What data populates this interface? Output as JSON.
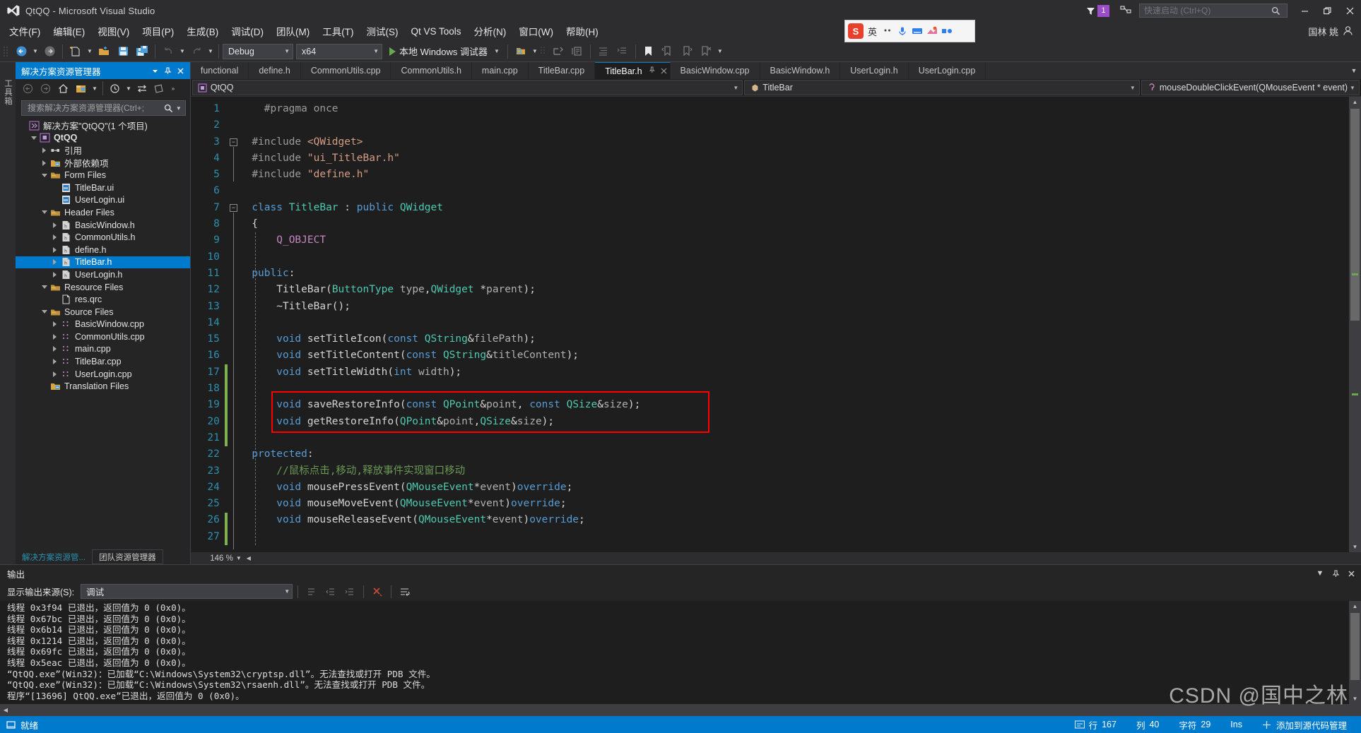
{
  "window": {
    "title": "QtQQ - Microsoft Visual Studio",
    "minimize_label": "–",
    "restore_label": "❐",
    "close_label": "✕",
    "notification_count": "1"
  },
  "quick_launch": {
    "placeholder": "快速启动 (Ctrl+Q)",
    "value": ""
  },
  "menu": {
    "items": [
      "文件(F)",
      "编辑(E)",
      "视图(V)",
      "项目(P)",
      "生成(B)",
      "调试(D)",
      "团队(M)",
      "工具(T)",
      "测试(S)",
      "Qt VS Tools",
      "分析(N)",
      "窗口(W)",
      "帮助(H)"
    ],
    "user": "国林 姚"
  },
  "ime_toolbar": {
    "s_logo": "S",
    "mode": "英"
  },
  "toolbar": {
    "config": "Debug",
    "platform": "x64",
    "run_label": "本地 Windows 调试器"
  },
  "solution_explorer": {
    "title": "解决方案资源管理器",
    "search_placeholder": "搜索解决方案资源管理器(Ctrl+;",
    "tree": [
      {
        "depth": 0,
        "arrow": "none",
        "icon": "solution-icon",
        "label": "解决方案\"QtQQ\"(1 个项目)",
        "bold": false,
        "selected": false
      },
      {
        "depth": 1,
        "arrow": "down",
        "icon": "project-icon",
        "label": "QtQQ",
        "bold": true,
        "selected": false
      },
      {
        "depth": 2,
        "arrow": "right",
        "icon": "references-icon",
        "label": "引用",
        "bold": false,
        "selected": false
      },
      {
        "depth": 2,
        "arrow": "right",
        "icon": "folder-ext-icon",
        "label": "外部依赖项",
        "bold": false,
        "selected": false
      },
      {
        "depth": 2,
        "arrow": "down",
        "icon": "filter-icon",
        "label": "Form Files",
        "bold": false,
        "selected": false
      },
      {
        "depth": 3,
        "arrow": "none",
        "icon": "ui-file-icon",
        "label": "TitleBar.ui",
        "bold": false,
        "selected": false
      },
      {
        "depth": 3,
        "arrow": "none",
        "icon": "ui-file-icon",
        "label": "UserLogin.ui",
        "bold": false,
        "selected": false
      },
      {
        "depth": 2,
        "arrow": "down",
        "icon": "filter-icon",
        "label": "Header Files",
        "bold": false,
        "selected": false
      },
      {
        "depth": 3,
        "arrow": "right",
        "icon": "h-file-icon",
        "label": "BasicWindow.h",
        "bold": false,
        "selected": false
      },
      {
        "depth": 3,
        "arrow": "right",
        "icon": "h-file-icon",
        "label": "CommonUtils.h",
        "bold": false,
        "selected": false
      },
      {
        "depth": 3,
        "arrow": "right",
        "icon": "h-file-icon",
        "label": "define.h",
        "bold": false,
        "selected": false
      },
      {
        "depth": 3,
        "arrow": "right",
        "icon": "h-file-icon",
        "label": "TitleBar.h",
        "bold": false,
        "selected": true
      },
      {
        "depth": 3,
        "arrow": "right",
        "icon": "h-file-icon",
        "label": "UserLogin.h",
        "bold": false,
        "selected": false
      },
      {
        "depth": 2,
        "arrow": "down",
        "icon": "filter-icon",
        "label": "Resource Files",
        "bold": false,
        "selected": false
      },
      {
        "depth": 3,
        "arrow": "none",
        "icon": "file-icon",
        "label": "res.qrc",
        "bold": false,
        "selected": false
      },
      {
        "depth": 2,
        "arrow": "down",
        "icon": "filter-icon",
        "label": "Source Files",
        "bold": false,
        "selected": false
      },
      {
        "depth": 3,
        "arrow": "right",
        "icon": "cpp-file-icon",
        "label": "BasicWindow.cpp",
        "bold": false,
        "selected": false
      },
      {
        "depth": 3,
        "arrow": "right",
        "icon": "cpp-file-icon",
        "label": "CommonUtils.cpp",
        "bold": false,
        "selected": false
      },
      {
        "depth": 3,
        "arrow": "right",
        "icon": "cpp-file-icon",
        "label": "main.cpp",
        "bold": false,
        "selected": false
      },
      {
        "depth": 3,
        "arrow": "right",
        "icon": "cpp-file-icon",
        "label": "TitleBar.cpp",
        "bold": false,
        "selected": false
      },
      {
        "depth": 3,
        "arrow": "right",
        "icon": "cpp-file-icon",
        "label": "UserLogin.cpp",
        "bold": false,
        "selected": false
      },
      {
        "depth": 2,
        "arrow": "none",
        "icon": "folder-ext-icon",
        "label": "Translation Files",
        "bold": false,
        "selected": false
      }
    ],
    "bottom_tabs": [
      {
        "label": "解决方案资源管...",
        "active": true
      },
      {
        "label": "团队资源管理器",
        "active": false
      }
    ]
  },
  "vertical_tabs": [
    "工具箱"
  ],
  "editor": {
    "tabs": [
      {
        "label": "functional",
        "active": false
      },
      {
        "label": "define.h",
        "active": false
      },
      {
        "label": "CommonUtils.cpp",
        "active": false
      },
      {
        "label": "CommonUtils.h",
        "active": false
      },
      {
        "label": "main.cpp",
        "active": false
      },
      {
        "label": "TitleBar.cpp",
        "active": false
      },
      {
        "label": "TitleBar.h",
        "active": true
      },
      {
        "label": "BasicWindow.cpp",
        "active": false
      },
      {
        "label": "BasicWindow.h",
        "active": false
      },
      {
        "label": "UserLogin.h",
        "active": false
      },
      {
        "label": "UserLogin.cpp",
        "active": false
      }
    ],
    "nav_project": "QtQQ",
    "nav_class": "TitleBar",
    "nav_member": "mouseDoubleClickEvent(QMouseEvent * event)",
    "zoom": "146 %",
    "highlight_color": "#ff0000",
    "lines": [
      {
        "n": 1,
        "tokens": [
          {
            "t": "    ",
            "c": "pl"
          },
          {
            "t": "#pragma once",
            "c": "pp"
          }
        ]
      },
      {
        "n": 2,
        "tokens": []
      },
      {
        "n": 3,
        "tokens": [
          {
            "t": "  ",
            "c": "pl"
          },
          {
            "t": "#include ",
            "c": "pp"
          },
          {
            "t": "<QWidget>",
            "c": "str"
          }
        ]
      },
      {
        "n": 4,
        "tokens": [
          {
            "t": "  ",
            "c": "pl"
          },
          {
            "t": "#include ",
            "c": "pp"
          },
          {
            "t": "\"ui_TitleBar.h\"",
            "c": "str"
          }
        ]
      },
      {
        "n": 5,
        "tokens": [
          {
            "t": "  ",
            "c": "pl"
          },
          {
            "t": "#include ",
            "c": "pp"
          },
          {
            "t": "\"define.h\"",
            "c": "str"
          }
        ]
      },
      {
        "n": 6,
        "tokens": []
      },
      {
        "n": 7,
        "tokens": [
          {
            "t": "  ",
            "c": "pl"
          },
          {
            "t": "class",
            "c": "k"
          },
          {
            "t": " ",
            "c": "pl"
          },
          {
            "t": "TitleBar",
            "c": "kv"
          },
          {
            "t": " : ",
            "c": "pl"
          },
          {
            "t": "public",
            "c": "k"
          },
          {
            "t": " ",
            "c": "pl"
          },
          {
            "t": "QWidget",
            "c": "kv"
          }
        ]
      },
      {
        "n": 8,
        "tokens": [
          {
            "t": "  {",
            "c": "pl"
          }
        ]
      },
      {
        "n": 9,
        "tokens": [
          {
            "t": "      ",
            "c": "pl"
          },
          {
            "t": "Q_OBJECT",
            "c": "mac"
          }
        ]
      },
      {
        "n": 10,
        "tokens": []
      },
      {
        "n": 11,
        "tokens": [
          {
            "t": "  ",
            "c": "pl"
          },
          {
            "t": "public",
            "c": "k"
          },
          {
            "t": ":",
            "c": "pl"
          }
        ]
      },
      {
        "n": 12,
        "tokens": [
          {
            "t": "      ",
            "c": "pl"
          },
          {
            "t": "TitleBar",
            "c": "pl"
          },
          {
            "t": "(",
            "c": "pl"
          },
          {
            "t": "ButtonType",
            "c": "kv"
          },
          {
            "t": " ",
            "c": "pl"
          },
          {
            "t": "type",
            "c": "pg"
          },
          {
            "t": ",",
            "c": "pl"
          },
          {
            "t": "QWidget",
            "c": "kv"
          },
          {
            "t": " *",
            "c": "pl"
          },
          {
            "t": "parent",
            "c": "pg"
          },
          {
            "t": ");",
            "c": "pl"
          }
        ]
      },
      {
        "n": 13,
        "tokens": [
          {
            "t": "      ~TitleBar();",
            "c": "pl"
          }
        ]
      },
      {
        "n": 14,
        "tokens": []
      },
      {
        "n": 15,
        "tokens": [
          {
            "t": "      ",
            "c": "pl"
          },
          {
            "t": "void",
            "c": "k"
          },
          {
            "t": " setTitleIcon(",
            "c": "pl"
          },
          {
            "t": "const",
            "c": "k"
          },
          {
            "t": " ",
            "c": "pl"
          },
          {
            "t": "QString",
            "c": "kv"
          },
          {
            "t": "&",
            "c": "pl"
          },
          {
            "t": "filePath",
            "c": "pg"
          },
          {
            "t": ");",
            "c": "pl"
          }
        ]
      },
      {
        "n": 16,
        "tokens": [
          {
            "t": "      ",
            "c": "pl"
          },
          {
            "t": "void",
            "c": "k"
          },
          {
            "t": " setTitleContent(",
            "c": "pl"
          },
          {
            "t": "const",
            "c": "k"
          },
          {
            "t": " ",
            "c": "pl"
          },
          {
            "t": "QString",
            "c": "kv"
          },
          {
            "t": "&",
            "c": "pl"
          },
          {
            "t": "titleContent",
            "c": "pg"
          },
          {
            "t": ");",
            "c": "pl"
          }
        ]
      },
      {
        "n": 17,
        "tokens": [
          {
            "t": "      ",
            "c": "pl"
          },
          {
            "t": "void",
            "c": "k"
          },
          {
            "t": " setTitleWidth(",
            "c": "pl"
          },
          {
            "t": "int",
            "c": "k"
          },
          {
            "t": " ",
            "c": "pl"
          },
          {
            "t": "width",
            "c": "pg"
          },
          {
            "t": ");",
            "c": "pl"
          }
        ]
      },
      {
        "n": 18,
        "tokens": []
      },
      {
        "n": 19,
        "tokens": [
          {
            "t": "      ",
            "c": "pl"
          },
          {
            "t": "void",
            "c": "k"
          },
          {
            "t": " saveRestoreInfo(",
            "c": "pl"
          },
          {
            "t": "const",
            "c": "k"
          },
          {
            "t": " ",
            "c": "pl"
          },
          {
            "t": "QPoint",
            "c": "kv"
          },
          {
            "t": "&",
            "c": "pl"
          },
          {
            "t": "point",
            "c": "pg"
          },
          {
            "t": ", ",
            "c": "pl"
          },
          {
            "t": "const",
            "c": "k"
          },
          {
            "t": " ",
            "c": "pl"
          },
          {
            "t": "QSize",
            "c": "kv"
          },
          {
            "t": "&",
            "c": "pl"
          },
          {
            "t": "size",
            "c": "pg"
          },
          {
            "t": ");",
            "c": "pl"
          }
        ]
      },
      {
        "n": 20,
        "tokens": [
          {
            "t": "      ",
            "c": "pl"
          },
          {
            "t": "void",
            "c": "k"
          },
          {
            "t": " getRestoreInfo(",
            "c": "pl"
          },
          {
            "t": "QPoint",
            "c": "kv"
          },
          {
            "t": "&",
            "c": "pl"
          },
          {
            "t": "point",
            "c": "pg"
          },
          {
            "t": ",",
            "c": "pl"
          },
          {
            "t": "QSize",
            "c": "kv"
          },
          {
            "t": "&",
            "c": "pl"
          },
          {
            "t": "size",
            "c": "pg"
          },
          {
            "t": ");",
            "c": "pl"
          }
        ]
      },
      {
        "n": 21,
        "tokens": []
      },
      {
        "n": 22,
        "tokens": [
          {
            "t": "  ",
            "c": "pl"
          },
          {
            "t": "protected",
            "c": "k"
          },
          {
            "t": ":",
            "c": "pl"
          }
        ]
      },
      {
        "n": 23,
        "tokens": [
          {
            "t": "      ",
            "c": "pl"
          },
          {
            "t": "//鼠标点击,移动,释放事件实现窗口移动",
            "c": "cm"
          }
        ]
      },
      {
        "n": 24,
        "tokens": [
          {
            "t": "      ",
            "c": "pl"
          },
          {
            "t": "void",
            "c": "k"
          },
          {
            "t": " mousePressEvent(",
            "c": "pl"
          },
          {
            "t": "QMouseEvent",
            "c": "kv"
          },
          {
            "t": "*",
            "c": "pl"
          },
          {
            "t": "event",
            "c": "pg"
          },
          {
            "t": ")",
            "c": "pl"
          },
          {
            "t": "override",
            "c": "k"
          },
          {
            "t": ";",
            "c": "pl"
          }
        ]
      },
      {
        "n": 25,
        "tokens": [
          {
            "t": "      ",
            "c": "pl"
          },
          {
            "t": "void",
            "c": "k"
          },
          {
            "t": " mouseMoveEvent(",
            "c": "pl"
          },
          {
            "t": "QMouseEvent",
            "c": "kv"
          },
          {
            "t": "*",
            "c": "pl"
          },
          {
            "t": "event",
            "c": "pg"
          },
          {
            "t": ")",
            "c": "pl"
          },
          {
            "t": "override",
            "c": "k"
          },
          {
            "t": ";",
            "c": "pl"
          }
        ]
      },
      {
        "n": 26,
        "tokens": [
          {
            "t": "      ",
            "c": "pl"
          },
          {
            "t": "void",
            "c": "k"
          },
          {
            "t": " mouseReleaseEvent(",
            "c": "pl"
          },
          {
            "t": "QMouseEvent",
            "c": "kv"
          },
          {
            "t": "*",
            "c": "pl"
          },
          {
            "t": "event",
            "c": "pg"
          },
          {
            "t": ")",
            "c": "pl"
          },
          {
            "t": "override",
            "c": "k"
          },
          {
            "t": ";",
            "c": "pl"
          }
        ]
      },
      {
        "n": 27,
        "tokens": []
      }
    ]
  },
  "output": {
    "title": "输出",
    "source_label": "显示输出来源(S):",
    "source_value": "调试",
    "lines": [
      "线程 0x3f94 已退出，返回值为 0 (0x0)。",
      "线程 0x67bc 已退出，返回值为 0 (0x0)。",
      "线程 0x6b14 已退出，返回值为 0 (0x0)。",
      "线程 0x1214 已退出，返回值为 0 (0x0)。",
      "线程 0x69fc 已退出，返回值为 0 (0x0)。",
      "线程 0x5eac 已退出，返回值为 0 (0x0)。",
      "“QtQQ.exe”(Win32)：已加载“C:\\Windows\\System32\\cryptsp.dll”。无法查找或打开 PDB 文件。",
      "“QtQQ.exe”(Win32)：已加载“C:\\Windows\\System32\\rsaenh.dll”。无法查找或打开 PDB 文件。",
      "程序“[13696] QtQQ.exe”已退出，返回值为 0 (0x0)。"
    ]
  },
  "statusbar": {
    "ready": "就绪",
    "line_label": "行",
    "line_value": "167",
    "col_label": "列",
    "col_value": "40",
    "char_label": "字符",
    "char_value": "29",
    "ins": "Ins",
    "add_source_control": "添加到源代码管理"
  },
  "watermark": {
    "text": "CSDN @国中之林"
  },
  "colors": {
    "accent": "#007acc",
    "chrome": "#2d2d30",
    "panel": "#252526",
    "editor_bg": "#1e1e1e",
    "highlight_red": "#ff0000",
    "badge_purple": "#9b4dca"
  }
}
